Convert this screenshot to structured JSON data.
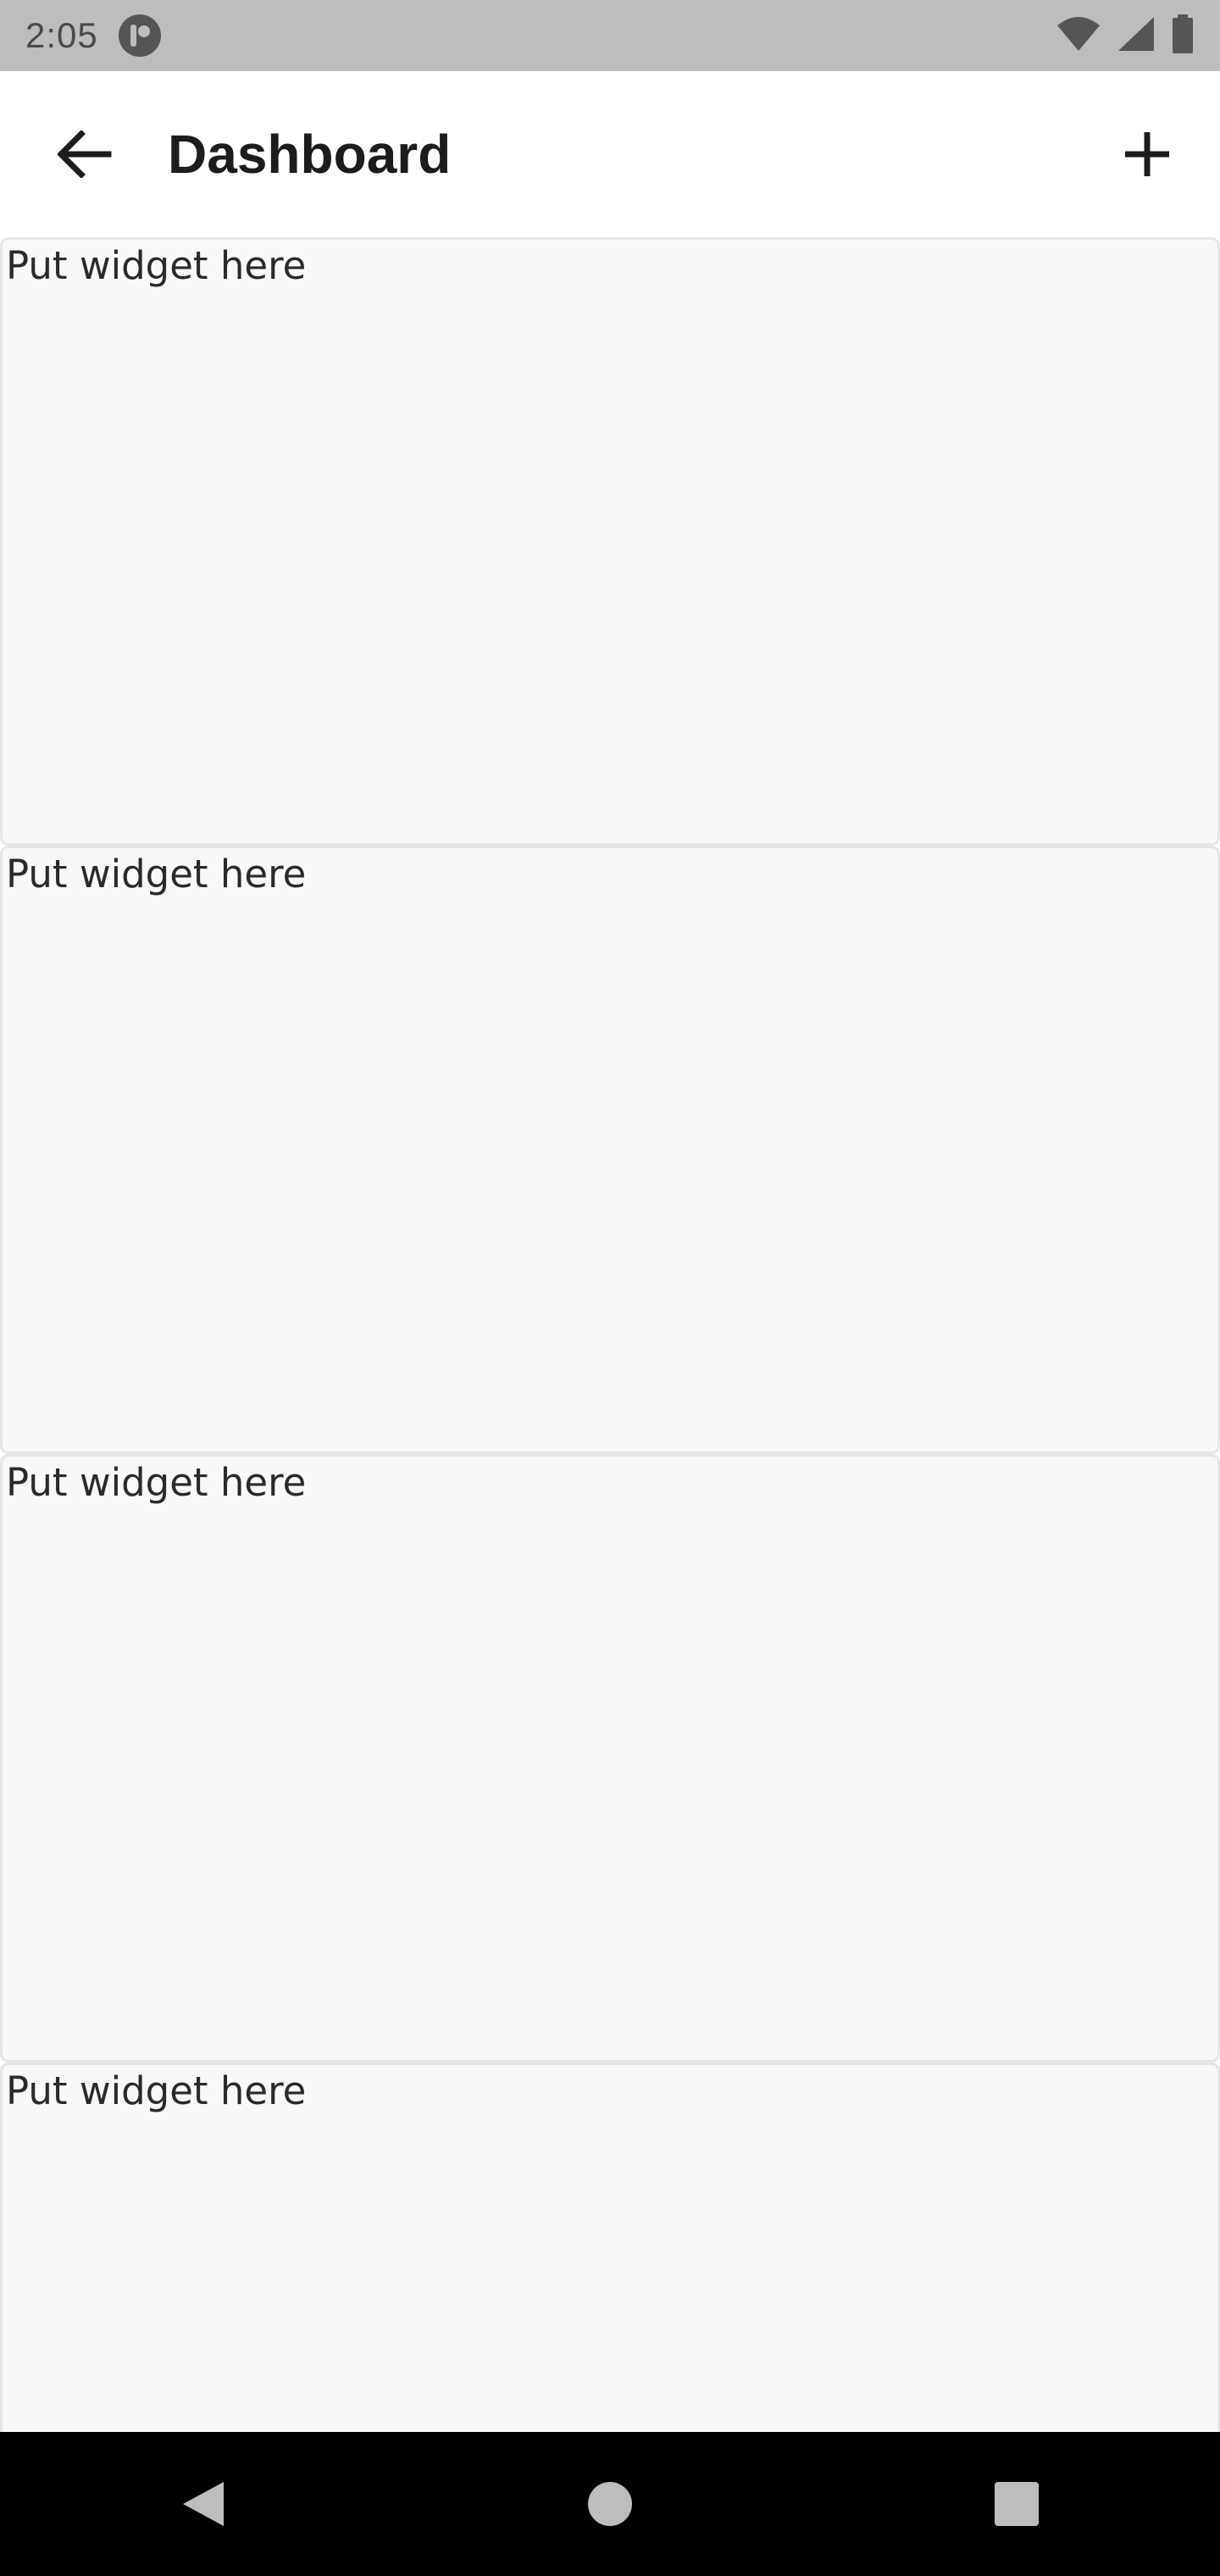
{
  "status_bar": {
    "time": "2:05",
    "icons": [
      "app-notification-icon",
      "wifi-icon",
      "signal-icon",
      "battery-icon"
    ]
  },
  "app_bar": {
    "title": "Dashboard",
    "back_icon": "arrow-left-icon",
    "add_icon": "plus-icon"
  },
  "widgets": [
    {
      "label": "Put widget here"
    },
    {
      "label": "Put widget here"
    },
    {
      "label": "Put widget here"
    },
    {
      "label": "Put widget here"
    }
  ],
  "nav_bar": {
    "icons": [
      "back-triangle-icon",
      "home-circle-icon",
      "recents-square-icon"
    ]
  },
  "colors": {
    "status_bar_bg": "#bdbdbd",
    "card_bg": "#f8f8f8",
    "card_border": "#e6e6e6",
    "nav_bar_bg": "#000000"
  }
}
